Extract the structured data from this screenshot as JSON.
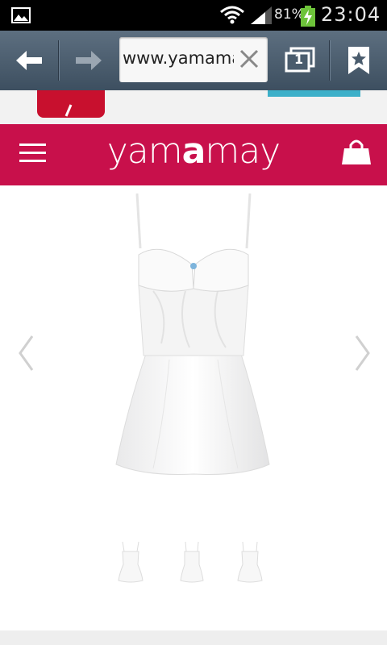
{
  "status_bar": {
    "battery_percent": "81%",
    "time": "23:04"
  },
  "browser": {
    "url": "www.yamamay.",
    "tab_count": "1"
  },
  "site": {
    "logo_parts": [
      "yam",
      "a",
      "may"
    ],
    "brand_color": "#c8104b"
  },
  "colors": {
    "toolbar": "#4a5c6d",
    "header": "#c8104b",
    "accent_teal": "#3db0c9"
  },
  "icons": {
    "back": "arrow-left-icon",
    "forward": "arrow-right-icon",
    "clear": "close-icon",
    "tabs": "tabs-icon",
    "bookmarks": "bookmark-star-icon",
    "menu": "hamburger-menu-icon",
    "cart": "shopping-bag-icon",
    "prev": "chevron-left-icon",
    "next": "chevron-right-icon"
  },
  "gallery": {
    "thumbnail_count": 3
  }
}
